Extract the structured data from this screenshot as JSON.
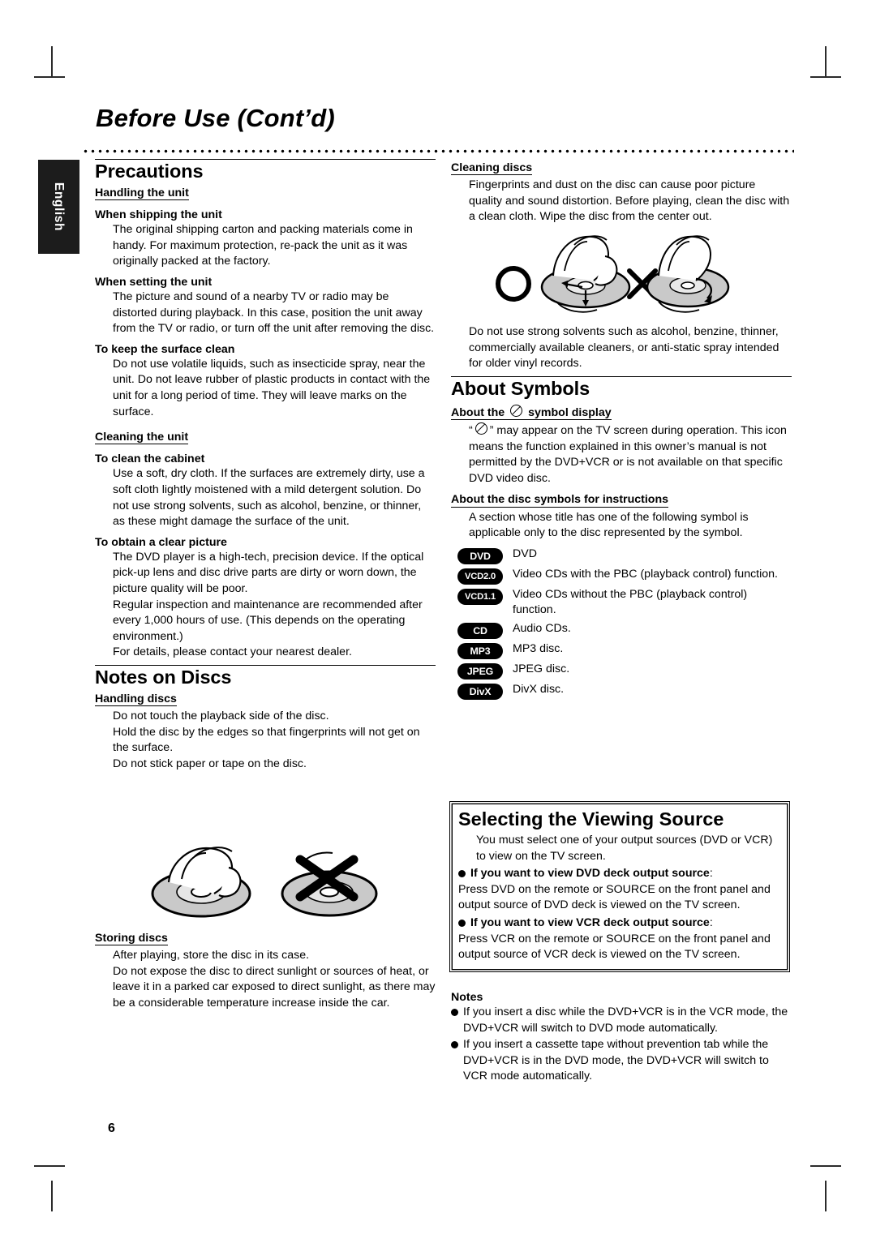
{
  "page": {
    "title": "Before Use (Cont’d)",
    "language_tab": "English",
    "page_number": "6"
  },
  "left_column": {
    "precautions": {
      "heading": "Precautions",
      "handling_unit_heading": "Handling the unit",
      "blocks": [
        {
          "sub": "When shipping the unit",
          "text": "The original shipping carton and packing materials come in handy. For maximum protection, re-pack the unit as it was originally packed at the factory."
        },
        {
          "sub": "When setting the unit",
          "text": "The picture and sound of a nearby TV or radio may be distorted during playback. In this case, position the unit away from the TV or radio, or turn off the unit after removing the disc."
        },
        {
          "sub": "To keep the surface clean",
          "text": "Do not use volatile liquids, such as insecticide spray, near the unit. Do not leave rubber of plastic products in contact with the unit for a long period of time. They will leave marks on the surface."
        }
      ],
      "cleaning_unit_heading": "Cleaning the unit",
      "cleaning_blocks": [
        {
          "sub": "To clean the cabinet",
          "text": "Use a soft, dry cloth. If the surfaces are extremely dirty, use a soft cloth lightly moistened with a mild detergent solution. Do not use strong solvents, such as alcohol, benzine, or thinner, as these might damage the surface of the unit."
        },
        {
          "sub": "To obtain a clear picture",
          "text": "The DVD player is a high-tech, precision device. If the optical pick-up lens and disc drive parts are dirty or worn down, the picture quality will be poor."
        }
      ],
      "clear_picture_extra_1": "Regular inspection and maintenance are recommended after every 1,000 hours of use. (This depends on the operating environment.)",
      "clear_picture_extra_2": "For details, please contact your nearest dealer."
    },
    "notes_on_discs": {
      "heading": "Notes on Discs",
      "handling_heading": "Handling discs",
      "handling_lines": [
        "Do not touch the playback side of the disc.",
        "Hold the disc by the edges so that fingerprints will not get on the surface.",
        "Do not stick paper or tape on the disc."
      ],
      "storing_heading": "Storing discs",
      "storing_lines": [
        "After playing, store the disc in its case.",
        "Do not expose the disc to direct sunlight or sources of heat, or leave it in a parked car exposed to direct sunlight, as there may be a considerable temperature increase inside the car."
      ]
    }
  },
  "right_column": {
    "cleaning_discs": {
      "heading": "Cleaning discs",
      "text": "Fingerprints and dust on the disc can cause poor picture quality and sound distortion. Before playing, clean the disc with a clean cloth. Wipe the disc from the center out.",
      "after_illustration": "Do not use strong solvents such as alcohol, benzine, thinner, commercially available cleaners, or anti-static spray intended for older vinyl records."
    },
    "about_symbols": {
      "heading": "About Symbols",
      "symbol_display_heading_before": "About the",
      "symbol_display_heading_after": "symbol display",
      "symbol_display_text_prefix": "“",
      "symbol_display_text_suffix": "” may appear on the TV screen during operation. This icon means the function explained in this owner’s manual is not permitted by the DVD+VCR or is not available on that specific DVD video disc.",
      "disc_symbols_heading": "About the disc symbols for instructions",
      "disc_symbols_text": "A section whose title has one of the following symbol is applicable only to the disc represented by the symbol.",
      "symbols": [
        {
          "badge": "DVD",
          "desc": "DVD"
        },
        {
          "badge": "VCD2.0",
          "desc": "Video CDs with the PBC (playback control) function."
        },
        {
          "badge": "VCD1.1",
          "desc": "Video CDs without the PBC (playback control) function."
        },
        {
          "badge": "CD",
          "desc": "Audio CDs."
        },
        {
          "badge": "MP3",
          "desc": "MP3 disc."
        },
        {
          "badge": "JPEG",
          "desc": "JPEG disc."
        },
        {
          "badge": "DivX",
          "desc": "DivX disc."
        }
      ]
    },
    "viewing_source": {
      "heading": "Selecting the Viewing Source",
      "intro": "You must select one of your output sources (DVD or VCR) to view on the TV screen.",
      "items": [
        {
          "bold": "If you want to view DVD deck output source",
          "colon": ":",
          "text": "Press DVD on the remote or SOURCE on the front panel and output source of DVD deck is viewed on the TV screen."
        },
        {
          "bold": "If you want to view VCR deck output source",
          "colon": ":",
          "text": "Press VCR on the remote or SOURCE on the front panel and output source of VCR deck is viewed on the TV screen."
        }
      ]
    },
    "notes": {
      "heading": "Notes",
      "items": [
        "If you insert a disc while the DVD+VCR is in the VCR mode, the DVD+VCR will switch to DVD mode automatically.",
        "If you insert a cassette tape without prevention tab while the DVD+VCR is in the DVD mode, the DVD+VCR will switch to VCR mode automatically."
      ]
    }
  },
  "illustrations": {
    "disc_cleaning_correct": "circle-ok-mark",
    "disc_cleaning_wrong": "cross-x-mark",
    "handling_ok": "hand-holding-disc-by-edges",
    "handling_wrong": "disc-touched-with-x"
  }
}
